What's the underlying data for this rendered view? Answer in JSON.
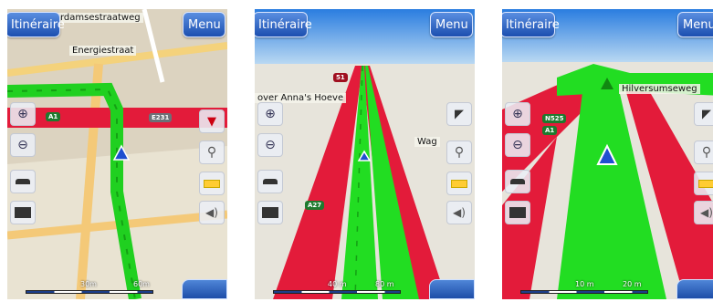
{
  "screens": [
    {
      "itinerary_label": "Itinéraire",
      "menu_label": "Menu",
      "streets": [
        "rdamsestraatweg",
        "Energiestraat"
      ],
      "road_shields": [
        "A1",
        "E231"
      ],
      "scale": [
        "30m",
        "60m"
      ]
    },
    {
      "itinerary_label": "Itinéraire",
      "menu_label": "Menu",
      "streets": [
        "over Anna's Hoeve",
        "Wag"
      ],
      "road_shields": [
        "A27",
        "51"
      ],
      "scale": [
        "40 m",
        "80 m"
      ]
    },
    {
      "itinerary_label": "Itinéraire",
      "menu_label": "Menu",
      "streets": [
        "Hilversumseweg"
      ],
      "road_shields": [
        "N525",
        "A1"
      ],
      "scale": [
        "10 m",
        "20 m"
      ]
    }
  ],
  "icons": {
    "zoom_in": "magnifier-plus-icon",
    "zoom_out": "magnifier-minus-icon",
    "tilt_up": "tilt-up-icon",
    "tilt_down": "tilt-down-icon",
    "compass": "compass-icon",
    "pin": "pin-icon",
    "battery": "battery-icon",
    "volume": "volume-icon",
    "position": "gps-position-arrow-icon"
  },
  "colors": {
    "route": "#22dd22",
    "motorway": "#e8203a",
    "button": "#2a5cc0"
  }
}
